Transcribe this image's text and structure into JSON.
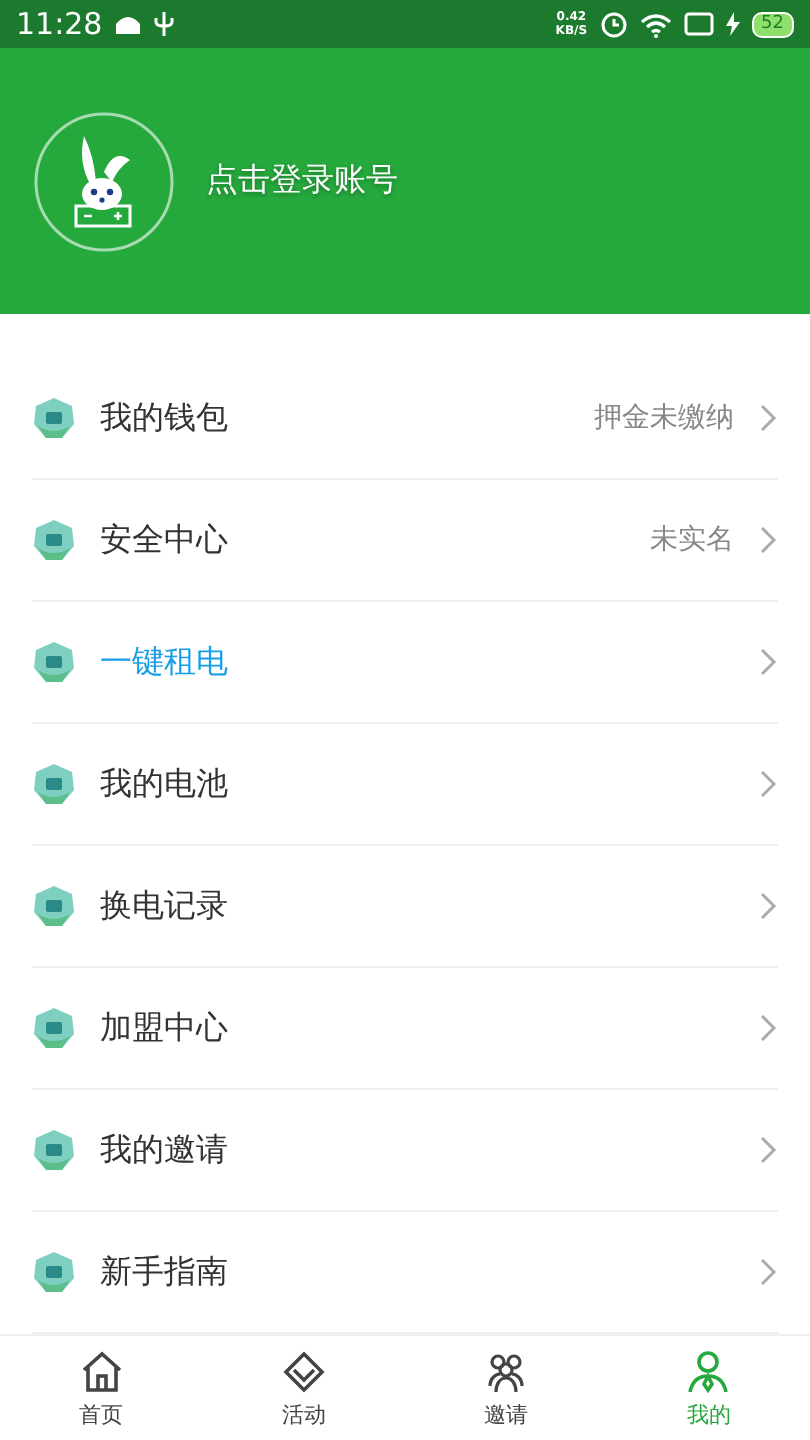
{
  "status_bar": {
    "time": "11:28",
    "speed_value": "0.42",
    "speed_unit": "KB/S",
    "battery": "52"
  },
  "header": {
    "login_text": "点击登录账号"
  },
  "menu": [
    {
      "label": "我的钱包",
      "value": "押金未缴纳",
      "selected": false
    },
    {
      "label": "安全中心",
      "value": "未实名",
      "selected": false
    },
    {
      "label": "一键租电",
      "selected": true
    },
    {
      "label": "我的电池",
      "selected": false
    },
    {
      "label": "换电记录",
      "selected": false
    },
    {
      "label": "加盟中心",
      "selected": false
    },
    {
      "label": "我的邀请",
      "selected": false
    },
    {
      "label": "新手指南",
      "selected": false
    }
  ],
  "tab_bar": [
    {
      "label": "首页",
      "kind": "home",
      "selected": false
    },
    {
      "label": "活动",
      "kind": "activity",
      "selected": false
    },
    {
      "label": "邀请",
      "kind": "invite",
      "selected": false
    },
    {
      "label": "我的",
      "kind": "me",
      "selected": true
    }
  ]
}
